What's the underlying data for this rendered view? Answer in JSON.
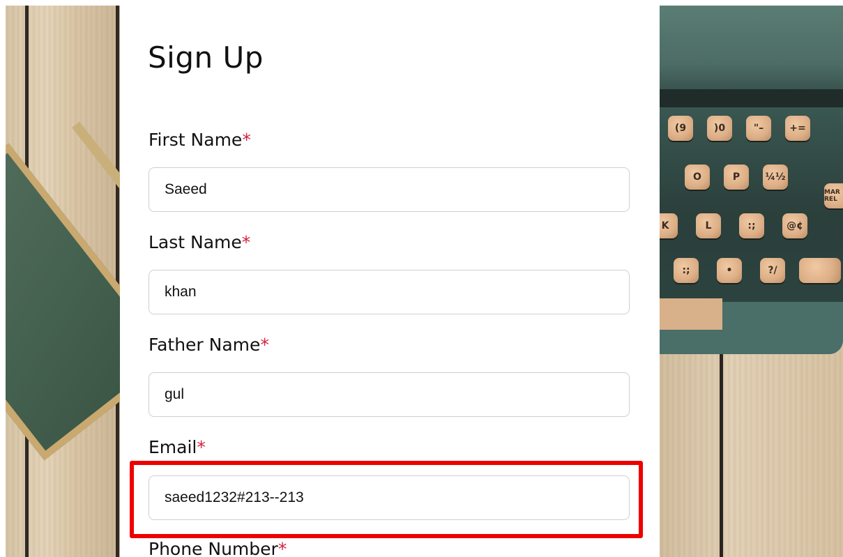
{
  "form": {
    "title": "Sign Up",
    "required_marker": "*",
    "fields": [
      {
        "label": "First Name",
        "value": "Saeed"
      },
      {
        "label": "Last Name",
        "value": "khan"
      },
      {
        "label": "Father Name",
        "value": "gul"
      },
      {
        "label": "Email",
        "value": "saeed1232#213--213"
      },
      {
        "label": "Phone Number"
      }
    ]
  },
  "background": {
    "keys": [
      "(9",
      ")0",
      "\"–",
      "+=",
      "O",
      "P",
      "¼½",
      "K",
      "L",
      ":;",
      "@¢",
      ":;",
      "•",
      "?/"
    ],
    "key_tag": "MAR REL"
  },
  "highlight": {
    "color": "#ee0000",
    "target": "Email"
  },
  "colors": {
    "required": "#d6213d",
    "input_border": "#cfcfcf"
  }
}
